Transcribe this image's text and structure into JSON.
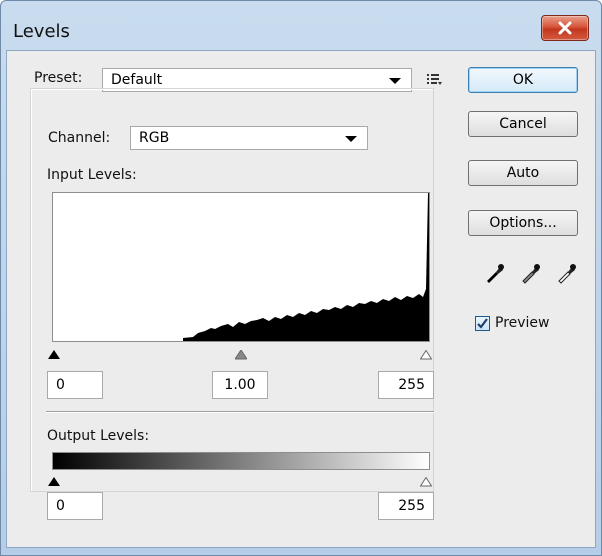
{
  "window": {
    "title": "Levels",
    "close_icon": "close-x-icon"
  },
  "preset": {
    "label": "Preset:",
    "value": "Default",
    "menu_icon": "preset-options-icon"
  },
  "channel": {
    "label": "Channel:",
    "value": "RGB"
  },
  "input_levels": {
    "label": "Input Levels:",
    "black": "0",
    "gamma": "1.00",
    "white": "255"
  },
  "output_levels": {
    "label": "Output Levels:",
    "black": "0",
    "white": "255"
  },
  "buttons": {
    "ok": "OK",
    "cancel": "Cancel",
    "auto": "Auto",
    "options": "Options..."
  },
  "eyedroppers": [
    "black-point-eyedropper-icon",
    "gray-point-eyedropper-icon",
    "white-point-eyedropper-icon"
  ],
  "preview": {
    "label": "Preview",
    "checked": true
  },
  "colors": {
    "accent": "#3c7fb1",
    "close": "#c2371f",
    "titlebar": "#c1d6ec"
  }
}
